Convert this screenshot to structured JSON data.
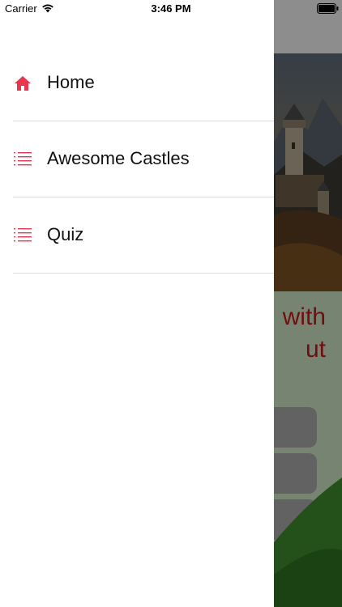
{
  "status_bar": {
    "carrier": "Carrier",
    "time": "3:46 PM",
    "wifi_icon": "wifi-icon",
    "battery_icon": "battery-full-icon"
  },
  "drawer": {
    "accent_color": "#e8364f",
    "items": [
      {
        "label": "Home",
        "icon": "home-icon",
        "selected": true
      },
      {
        "label": "Awesome Castles",
        "icon": "list-icon",
        "selected": false
      },
      {
        "label": "Quiz",
        "icon": "list-icon",
        "selected": false
      }
    ]
  },
  "background": {
    "headline_fragments": [
      "with",
      "ut"
    ],
    "headline_color": "#c4161c",
    "hero_image": "castle-photo"
  }
}
